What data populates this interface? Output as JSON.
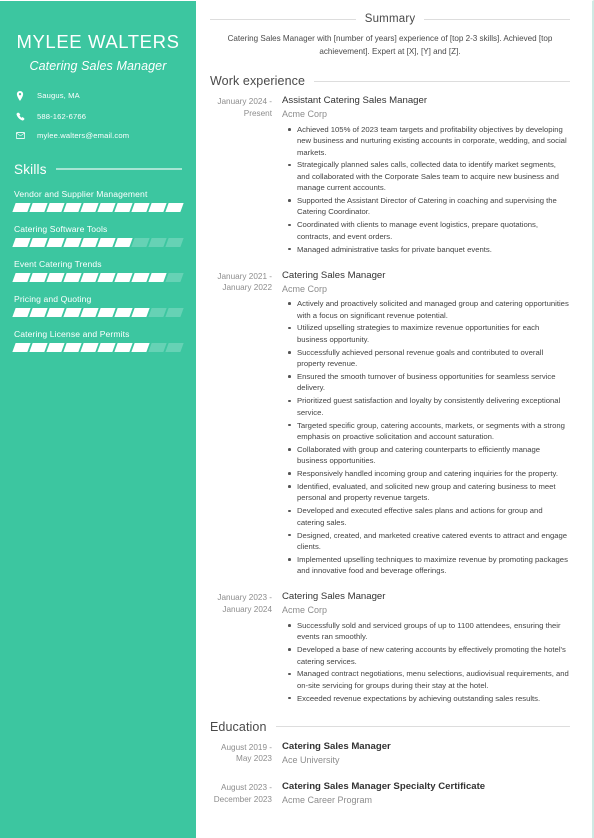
{
  "colors": {
    "sidebar_bg": "#3cc6a0",
    "sidebar_text": "#ffffff",
    "main_text": "#4a4a4a",
    "muted_text": "#8d8d8d",
    "rule": "#dddddd",
    "page_border": "#cfe9e3"
  },
  "sidebar": {
    "name": "MYLEE WALTERS",
    "job_title": "Catering Sales Manager",
    "contacts": [
      {
        "icon": "location-pin-icon",
        "text": "Saugus, MA"
      },
      {
        "icon": "phone-icon",
        "text": "588-162-6766"
      },
      {
        "icon": "envelope-icon",
        "text": "mylee.walters@email.com"
      }
    ],
    "skills_heading": "Skills",
    "skills": [
      {
        "label": "Vendor and Supplier Management",
        "filled": 10,
        "total": 10
      },
      {
        "label": "Catering Software Tools",
        "filled": 7,
        "total": 10
      },
      {
        "label": "Event Catering Trends",
        "filled": 9,
        "total": 10
      },
      {
        "label": "Pricing and Quoting",
        "filled": 8,
        "total": 10
      },
      {
        "label": "Catering License and Permits",
        "filled": 8,
        "total": 10
      }
    ]
  },
  "main": {
    "summary": {
      "heading": "Summary",
      "text": "Catering Sales Manager with [number of years] experience of [top 2-3 skills]. Achieved [top achievement]. Expert at [X], [Y] and [Z]."
    },
    "work_experience": {
      "heading": "Work experience",
      "entries": [
        {
          "dates": "January 2024 - Present",
          "role": "Assistant Catering Sales Manager",
          "org": "Acme Corp",
          "bullets": [
            "Achieved 105% of 2023 team targets and profitability objectives by developing new business and nurturing existing accounts in corporate, wedding, and social markets.",
            "Strategically planned sales calls, collected data to identify market segments, and collaborated with the Corporate Sales team to acquire new business and manage current accounts.",
            "Supported the Assistant Director of Catering in coaching and supervising the Catering Coordinator.",
            "Coordinated with clients to manage event logistics, prepare quotations, contracts, and event orders.",
            "Managed administrative tasks for private banquet events."
          ]
        },
        {
          "dates": "January 2021 - January 2022",
          "role": "Catering Sales Manager",
          "org": "Acme Corp",
          "bullets": [
            "Actively and proactively solicited and managed group and catering opportunities with a focus on significant revenue potential.",
            "Utilized upselling strategies to maximize revenue opportunities for each business opportunity.",
            "Successfully achieved personal revenue goals and contributed to overall property revenue.",
            "Ensured the smooth turnover of business opportunities for seamless service delivery.",
            "Prioritized guest satisfaction and loyalty by consistently delivering exceptional service.",
            "Targeted specific group, catering accounts, markets, or segments with a strong emphasis on proactive solicitation and account saturation.",
            "Collaborated with group and catering counterparts to efficiently manage business opportunities.",
            "Responsively handled incoming group and catering inquiries for the property.",
            "Identified, evaluated, and solicited new group and catering business to meet personal and property revenue targets.",
            "Developed and executed effective sales plans and actions for group and catering sales.",
            "Designed, created, and marketed creative catered events to attract and engage clients.",
            "Implemented upselling techniques to maximize revenue by promoting packages and innovative food and beverage offerings."
          ]
        },
        {
          "dates": "January 2023 - January 2024",
          "role": "Catering Sales Manager",
          "org": "Acme Corp",
          "bullets": [
            "Successfully sold and serviced groups of up to 1100 attendees, ensuring their events ran smoothly.",
            "Developed a base of new catering accounts by effectively promoting the hotel's catering services.",
            "Managed contract negotiations, menu selections, audiovisual requirements, and on-site servicing for groups during their stay at the hotel.",
            "Exceeded revenue expectations by achieving outstanding sales results."
          ]
        }
      ]
    },
    "education": {
      "heading": "Education",
      "entries": [
        {
          "dates": "August 2019 - May 2023",
          "degree": "Catering Sales Manager",
          "institution": "Ace University"
        },
        {
          "dates": "August 2023 - December 2023",
          "degree": "Catering Sales Manager Specialty Certificate",
          "institution": "Acme Career Program"
        }
      ]
    }
  }
}
